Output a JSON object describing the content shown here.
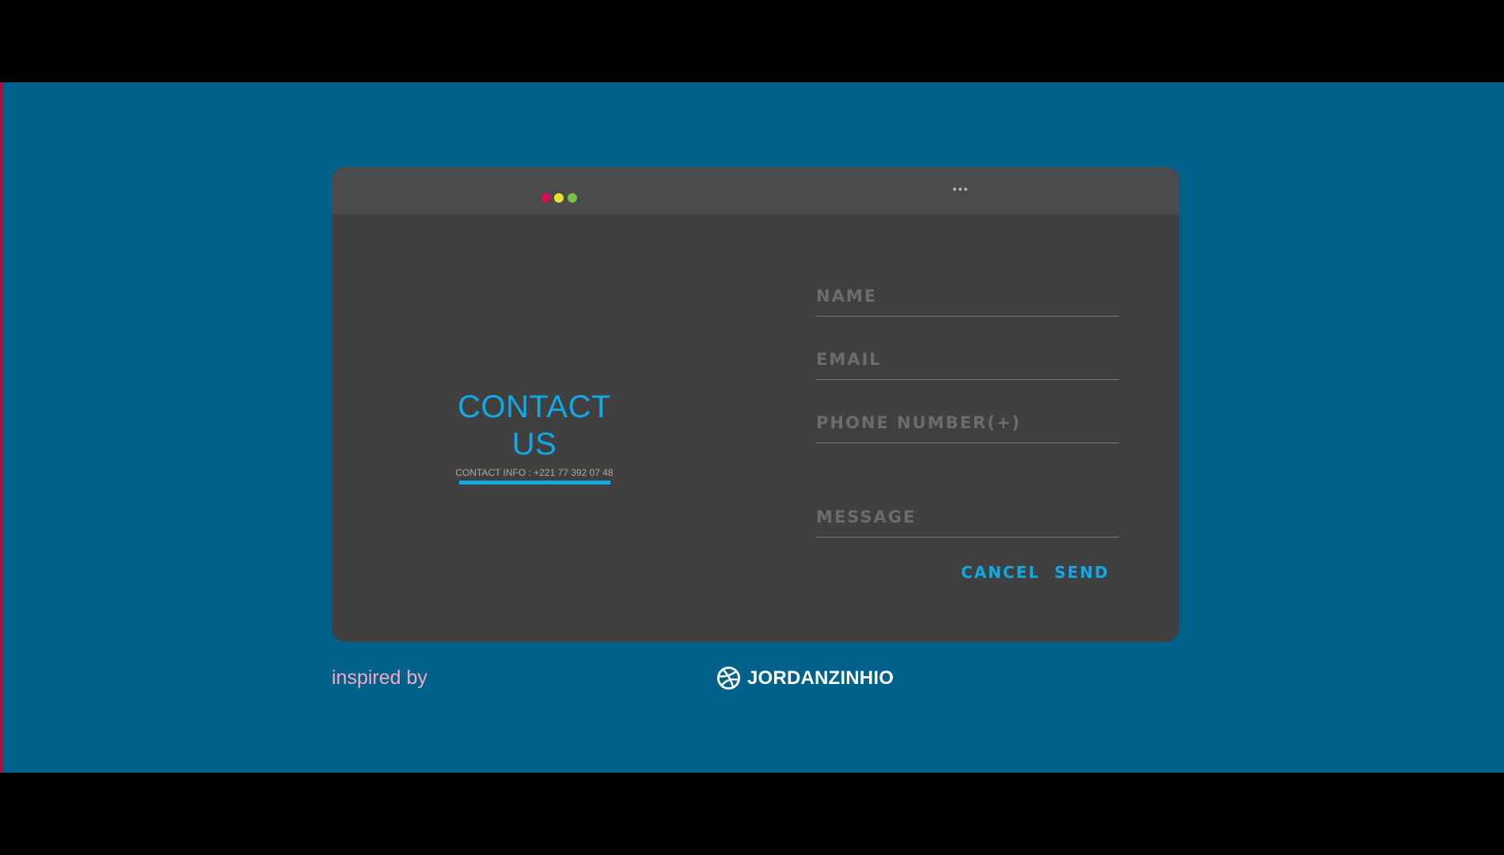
{
  "window": {
    "controls": [
      "close",
      "minimize",
      "maximize"
    ],
    "more_icon": "ellipsis-icon"
  },
  "contact": {
    "title": "CONTACT US",
    "info": "CONTACT INFO : +221 77 392 07 48"
  },
  "form": {
    "name_placeholder": "NAME",
    "email_placeholder": "EMAIL",
    "phone_placeholder": "PHONE NUMBER(+)",
    "message_placeholder": "MESSAGE",
    "cancel_label": "CANCEL",
    "send_label": "SEND"
  },
  "footer": {
    "inspired_text": "inspired by",
    "brand_icon": "dribbble-icon",
    "brand_name": "JORDANZINHIO"
  },
  "colors": {
    "background": "#00628a",
    "card": "#404040",
    "titlebar": "#4b4a4c",
    "accent": "#11a8e6",
    "close_dot": "#d3124d",
    "minimize_dot": "#e7e22d",
    "maximize_dot": "#7cbf45",
    "inspired_text": "#f3a9c6"
  }
}
